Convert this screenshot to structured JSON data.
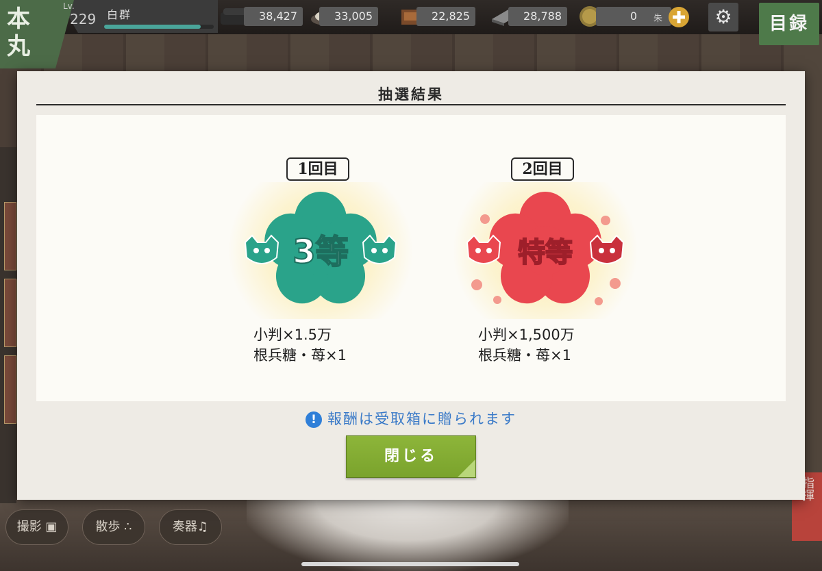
{
  "top_bar": {
    "home_label": [
      "本",
      "丸"
    ],
    "level_label": "Lv.",
    "level": "229",
    "player_name": "白群",
    "exp_fraction": 0.88,
    "resources": [
      {
        "icon": "charcoal-icon",
        "value": "38,427"
      },
      {
        "icon": "tamahagane-icon",
        "value": "33,005"
      },
      {
        "icon": "cooling-material-icon",
        "value": "22,825"
      },
      {
        "icon": "whetstone-icon",
        "value": "28,788"
      }
    ],
    "coin": {
      "icon": "koban-coin-icon",
      "value": "0",
      "unit": "朱"
    },
    "settings_icon": "gear-icon",
    "catalog_label": "目録"
  },
  "modal": {
    "title": "抽選結果",
    "draws": [
      {
        "label": "1回目",
        "rank": "3等",
        "rank_color": "#2aa38a",
        "reward_lines": [
          "小判×1.5万",
          "根兵糖・苺×1"
        ]
      },
      {
        "label": "2回目",
        "rank": "特等",
        "rank_color": "#e9474f",
        "reward_lines": [
          "小判×1,500万",
          "根兵糖・苺×1"
        ]
      }
    ],
    "notice": "報酬は受取箱に贈られます",
    "notice_icon": "!",
    "close_label": "閉じる"
  },
  "bottom_buttons": [
    {
      "label": "撮影",
      "icon": "camera-icon"
    },
    {
      "label": "散歩",
      "icon": "footprints-icon"
    },
    {
      "label": "奏器",
      "icon": "music-note-icon"
    }
  ],
  "side_right_label": "指揮"
}
